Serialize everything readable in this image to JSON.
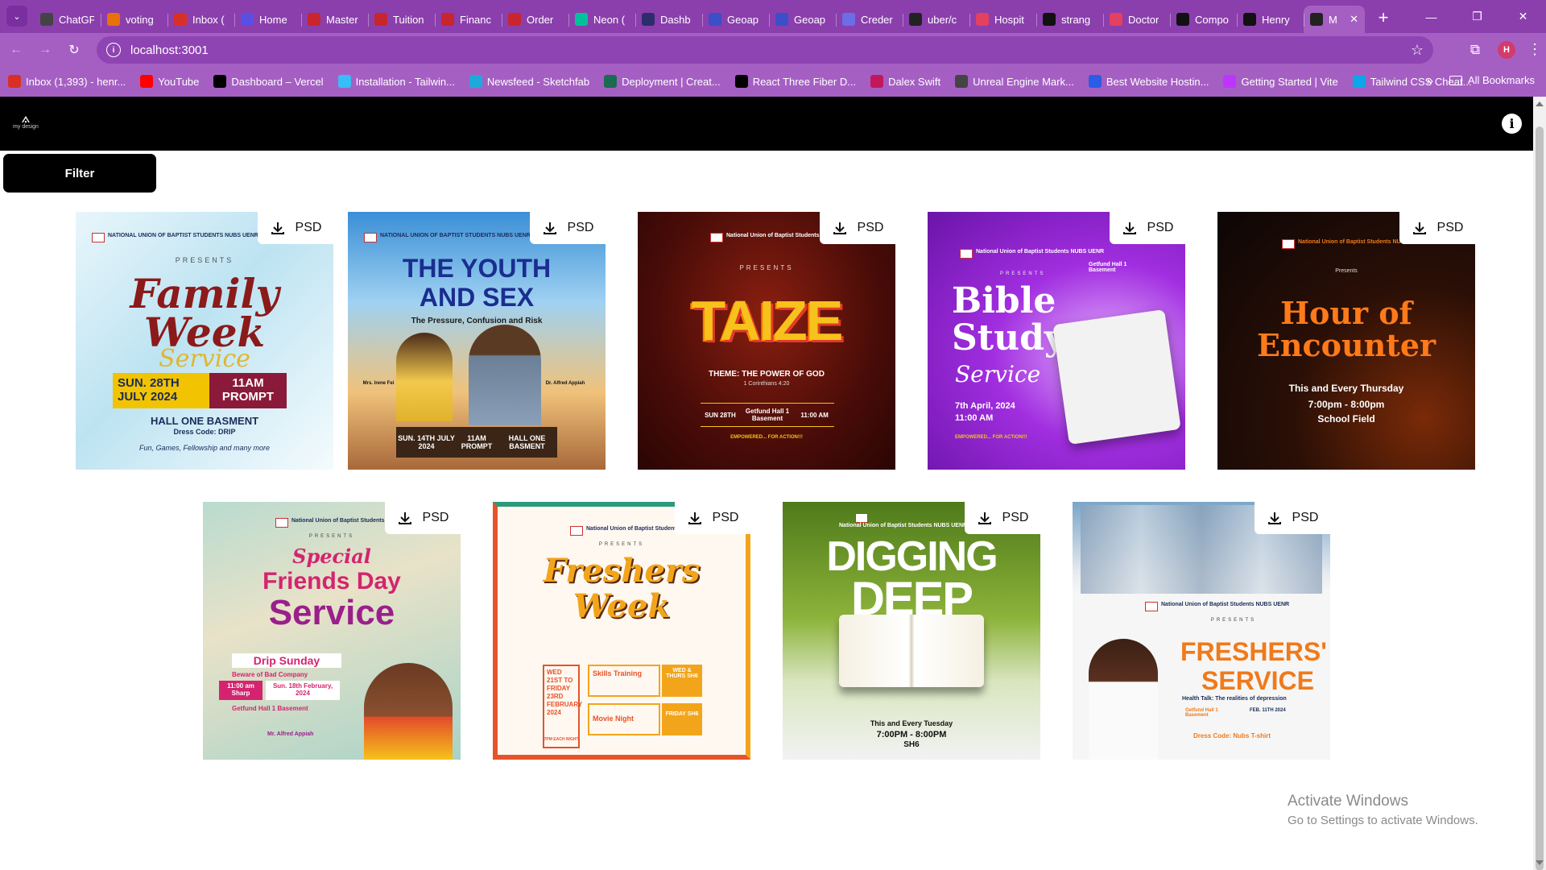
{
  "browser": {
    "tabs": [
      {
        "label": "ChatGPT",
        "color": "#444"
      },
      {
        "label": "voting",
        "color": "#e8710a"
      },
      {
        "label": "Inbox (",
        "color": "#d93025"
      },
      {
        "label": "Home",
        "color": "#5b4fe3"
      },
      {
        "label": "Master",
        "color": "#c9252c"
      },
      {
        "label": "Tuition",
        "color": "#c9252c"
      },
      {
        "label": "Financ",
        "color": "#c9252c"
      },
      {
        "label": "Order",
        "color": "#c9252c"
      },
      {
        "label": "Neon (",
        "color": "#00c29a"
      },
      {
        "label": "Dashb",
        "color": "#2d2d6b"
      },
      {
        "label": "Geoap",
        "color": "#3a4fc8"
      },
      {
        "label": "Geoap",
        "color": "#3a4fc8"
      },
      {
        "label": "Creder",
        "color": "#6a6fe8"
      },
      {
        "label": "uber/c",
        "color": "#222"
      },
      {
        "label": "Hospit",
        "color": "#e4405f"
      },
      {
        "label": "strang",
        "color": "#111"
      },
      {
        "label": "Doctor",
        "color": "#e4405f"
      },
      {
        "label": "Compo",
        "color": "#111"
      },
      {
        "label": "Henry",
        "color": "#111"
      },
      {
        "label": "M",
        "color": "#222",
        "active": true
      }
    ],
    "close_glyph": "✕",
    "new_tab_glyph": "+",
    "url": "localhost:3001",
    "profile_initial": "H",
    "bookmarks": [
      {
        "label": "Inbox (1,393) - henr...",
        "color": "#d93025"
      },
      {
        "label": "YouTube",
        "color": "#ff0000"
      },
      {
        "label": "Dashboard – Vercel",
        "color": "#000"
      },
      {
        "label": "Installation - Tailwin...",
        "color": "#38bdf8"
      },
      {
        "label": "Newsfeed - Sketchfab",
        "color": "#1caad9"
      },
      {
        "label": "Deployment | Creat...",
        "color": "#1a6b4f"
      },
      {
        "label": "React Three Fiber D...",
        "color": "#000"
      },
      {
        "label": "Dalex Swift",
        "color": "#c2185b"
      },
      {
        "label": "Unreal Engine Mark...",
        "color": "#444"
      },
      {
        "label": "Best Website Hostin...",
        "color": "#2b5ce6"
      },
      {
        "label": "Getting Started | Vite",
        "color": "#bd34fe"
      },
      {
        "label": "Tailwind CSS Cheat...",
        "color": "#0ea5e9"
      }
    ],
    "more_glyph": "»",
    "all_bookmarks": "All Bookmarks"
  },
  "app": {
    "logo_text": "my design",
    "info_glyph": "i",
    "filter_label": "Filter",
    "download_label": "PSD"
  },
  "posters": [
    {
      "org": "NATIONAL UNION OF BAPTIST STUDENTS\nNUBS UENR",
      "sub": "PRESENTS",
      "title": "Family Week",
      "script": "Service",
      "l1": "SUN. 28TH JULY 2024",
      "l2": "11AM PROMPT",
      "l3": "HALL ONE BASMENT",
      "l4": "Dress Code: DRIP",
      "l5": "Fun, Games, Fellowship and many more"
    },
    {
      "org": "NATIONAL UNION OF BAPTIST STUDENTS\nNUBS UENR",
      "title": "THE YOUTH AND SEX",
      "sub": "The Pressure, Confusion and Risk",
      "l1": "SUN. 14TH JULY 2024",
      "l2": "11AM PROMPT",
      "l3": "HALL ONE BASMENT",
      "n1": "Mrs. Irene Fei",
      "n2": "Dr. Alfred Appiah"
    },
    {
      "org": "National Union of Baptist Students\nNUBS UENR",
      "sub": "PRESENTS",
      "title": "TAIZE",
      "l1": "THEME: THE POWER OF GOD",
      "l2": "1 Corinthians 4:20",
      "l3": "SUN 28TH",
      "l4": "Getfund Hall 1 Basement",
      "l5": "11:00 AM",
      "l6": "EMPOWERED... FOR ACTION!!!"
    },
    {
      "org": "National Union of Baptist Students\nNUBS UENR",
      "sub": "PRESENTS",
      "loc": "Getfund Hall 1 Basement",
      "title": "Bible Study",
      "script": "Service",
      "l1": "7th April, 2024",
      "l2": "11:00 AM",
      "l3": "EMPOWERED... FOR ACTION!!!"
    },
    {
      "org": "National Union of Baptist Students\nNUBS UENR",
      "sub": "Presents",
      "title": "Hour of Encounter",
      "l1": "This and Every Thursday",
      "l2": "7:00pm - 8:00pm",
      "l3": "School Field"
    },
    {
      "org": "National Union of Baptist Students\nNUBS UENR",
      "sub": "PRESENTS",
      "title1": "Special",
      "title2": "Friends Day",
      "title3": "Service",
      "l1": "Drip Sunday",
      "l2": "Beware of Bad Company",
      "l3": "11:00 am Sharp",
      "l4": "Sun. 18th February, 2024",
      "l5": "Getfund Hall 1 Basement",
      "l6": "Mr. Alfred Appiah"
    },
    {
      "org": "National Union of Baptist Students\nNUBS UENR",
      "sub": "PRESENTS",
      "title1": "Freshers",
      "title2": "Week",
      "l1": "WED 21ST TO FRIDAY 23RD FEBRUARY 2024",
      "l2": "7PM EACH NIGHT",
      "l3": "Skills Training",
      "l4": "WED & THURS SH6",
      "l5": "Movie Night",
      "l6": "FRIDAY SH6"
    },
    {
      "org": "National Union of Baptist Students\nNUBS UENR",
      "title1": "DIGGING",
      "title2": "DEEP",
      "l1": "This and Every Tuesday",
      "l2": "7:00PM - 8:00PM",
      "l3": "SH6"
    },
    {
      "org": "National Union of Baptist Students\nNUBS UENR",
      "sub": "PRESENTS",
      "title1": "FRESHERS'",
      "title2": "SERVICE",
      "l1": "Health Talk: The realities of depression",
      "l2": "Getfund Hall 1 Basement",
      "l3": "FEB. 11TH 2024",
      "l4": "Dress Code: Nubs T-shirt"
    }
  ],
  "watermark": {
    "heading": "Activate Windows",
    "sub": "Go to Settings to activate Windows."
  }
}
